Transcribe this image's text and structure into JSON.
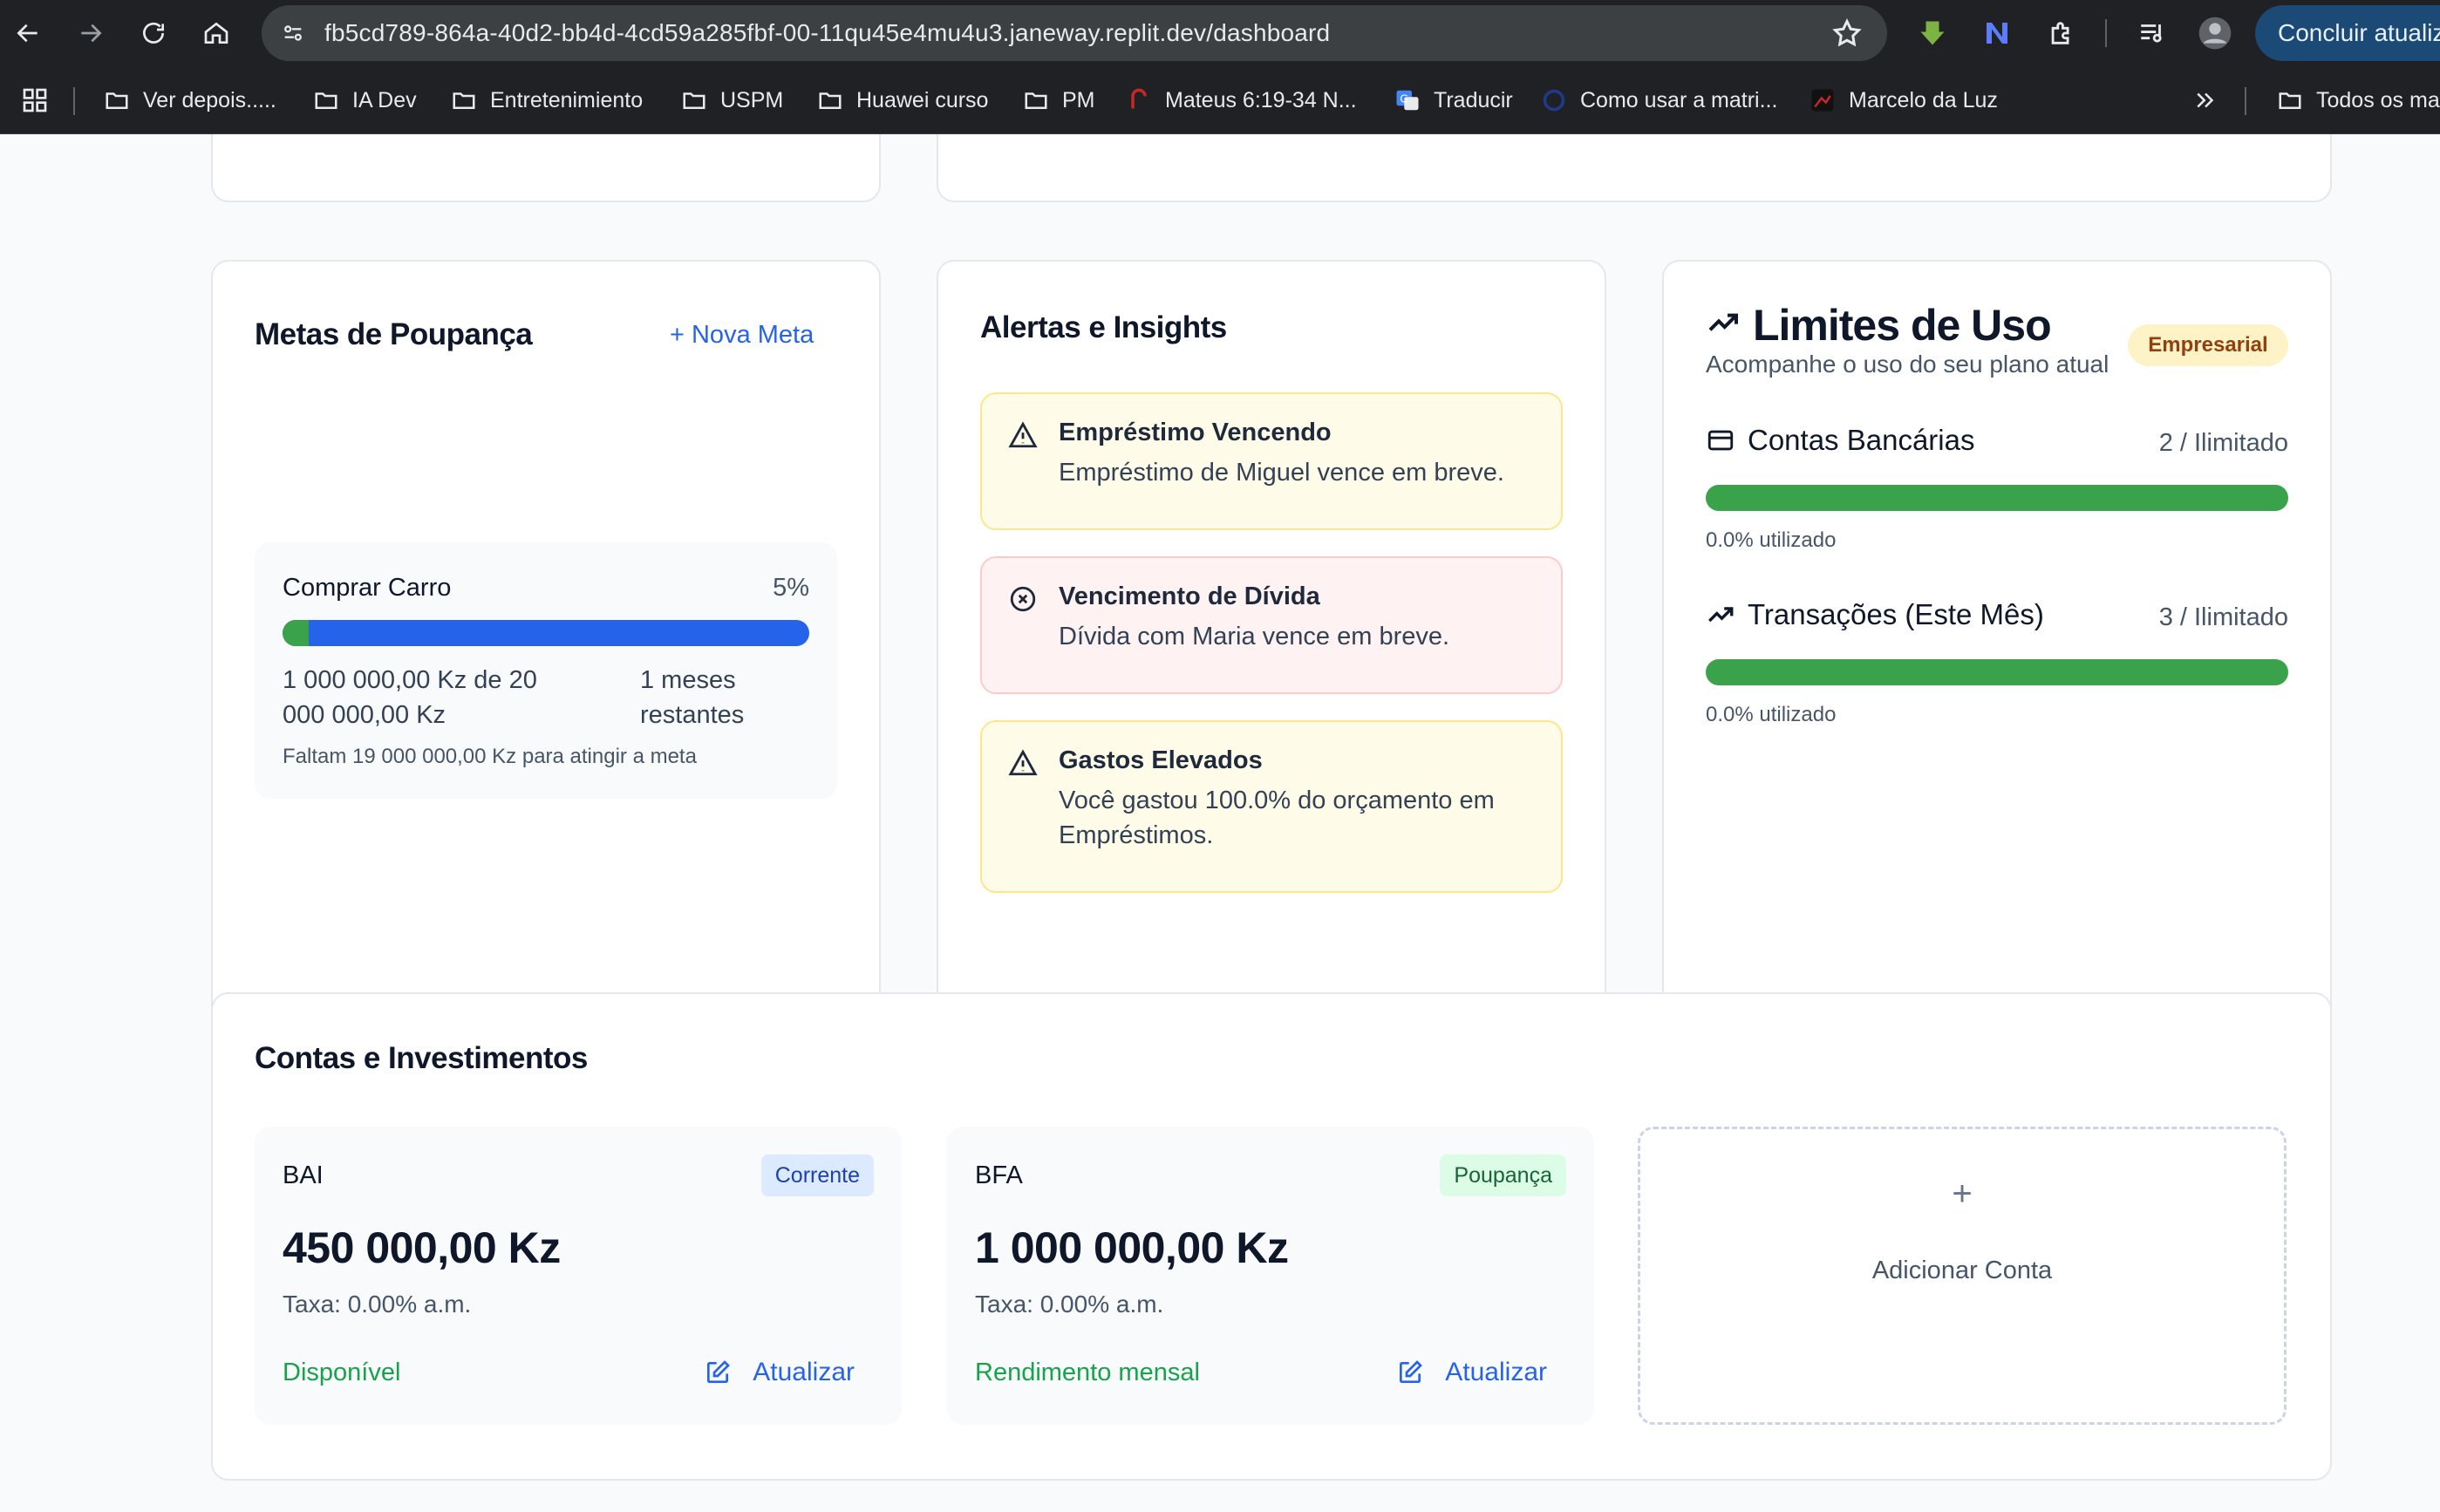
{
  "browser": {
    "url": "fb5cd789-864a-40d2-bb4d-4cd59a285fbf-00-11qu45e4mu4u3.janeway.replit.dev/dashboard",
    "update_label": "Concluir atualiz",
    "bookmarks": [
      {
        "label": "Ver depois.....",
        "icon": "folder-icon"
      },
      {
        "label": "IA Dev",
        "icon": "folder-icon"
      },
      {
        "label": "Entretenimiento",
        "icon": "folder-icon"
      },
      {
        "label": "USPM",
        "icon": "folder-icon"
      },
      {
        "label": "Huawei curso",
        "icon": "folder-icon"
      },
      {
        "label": "PM",
        "icon": "folder-icon"
      },
      {
        "label": "Mateus 6:19-34 N...",
        "icon": "bible-site-icon"
      },
      {
        "label": "Traducir",
        "icon": "translate-icon"
      },
      {
        "label": "Como usar a matri...",
        "icon": "circle-site-icon"
      },
      {
        "label": "Marcelo da Luz",
        "icon": "profile-site-icon"
      }
    ],
    "all_bookmarks_label": "Todos os ma"
  },
  "goals": {
    "title": "Metas de Poupança",
    "new_goal_label": "+ Nova Meta",
    "items": [
      {
        "name": "Comprar Carro",
        "percent_label": "5%",
        "progress": 0.05,
        "amount": "1 000 000,00 Kz de 20 000 000,00 Kz",
        "months_left": "1 meses restantes",
        "missing": "Faltam 19 000 000,00 Kz para atingir a meta"
      }
    ]
  },
  "alerts": {
    "title": "Alertas e Insights",
    "items": [
      {
        "type": "warning",
        "icon": "warning-triangle-icon",
        "title": "Empréstimo Vencendo",
        "text": "Empréstimo de Miguel vence em breve."
      },
      {
        "type": "error",
        "icon": "x-circle-icon",
        "title": "Vencimento de Dívida",
        "text": "Dívida com Maria vence em breve."
      },
      {
        "type": "warning",
        "icon": "warning-triangle-icon",
        "title": "Gastos Elevados",
        "text": "Você gastou 100.0% do orçamento em Empréstimos."
      }
    ]
  },
  "limits": {
    "title": "Limites de Uso",
    "subtitle": "Acompanhe o uso do seu plano atual",
    "plan_badge": "Empresarial",
    "rows": [
      {
        "label": "Contas Bancárias",
        "value": "2 / Ilimitado",
        "used_text": "0.0% utilizado",
        "used_fraction": 0.0,
        "icon": "credit-card-icon"
      },
      {
        "label": "Transações (Este Mês)",
        "value": "3 / Ilimitado",
        "used_text": "0.0% utilizado",
        "used_fraction": 0.0,
        "icon": "trending-up-icon"
      }
    ]
  },
  "accounts": {
    "title": "Contas e Investimentos",
    "items": [
      {
        "name": "BAI",
        "tag": "Corrente",
        "balance": "450 000,00 Kz",
        "rate": "Taxa: 0.00% a.m.",
        "status": "Disponível",
        "update_label": "Atualizar"
      },
      {
        "name": "BFA",
        "tag": "Poupança",
        "balance": "1 000 000,00 Kz",
        "rate": "Taxa: 0.00% a.m.",
        "status": "Rendimento mensal",
        "update_label": "Atualizar"
      }
    ],
    "add_plus": "+",
    "add_label": "Adicionar Conta"
  },
  "colors": {
    "accent_blue": "#2563eb",
    "progress_green": "#3aa24b",
    "warning_bg": "#fefce8",
    "error_bg": "#fef2f2",
    "plan_badge_bg": "#fef3c7"
  }
}
